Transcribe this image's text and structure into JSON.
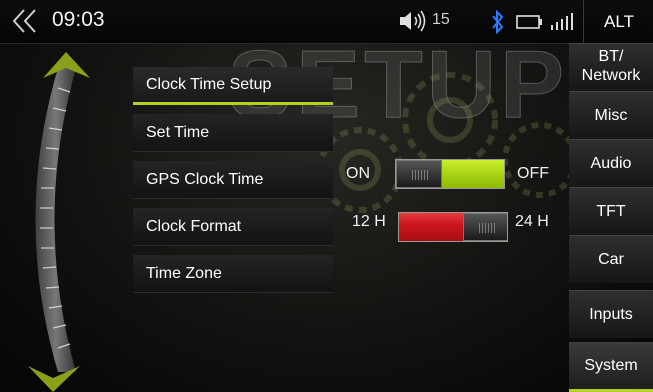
{
  "status": {
    "time": "09:03",
    "volume": "15",
    "alt_label": "ALT"
  },
  "background_title": "SETUP",
  "menu": [
    {
      "label": "Clock Time Setup",
      "active": true
    },
    {
      "label": "Set Time"
    },
    {
      "label": "GPS Clock Time"
    },
    {
      "label": "Clock Format"
    },
    {
      "label": "Time Zone"
    }
  ],
  "gps_toggle": {
    "left_label": "ON",
    "right_label": "OFF",
    "state": "ON",
    "on_color": "#a8d400"
  },
  "format_toggle": {
    "left_label": "12 H",
    "right_label": "24 H",
    "state": "12 H",
    "active_color": "#c8141b"
  },
  "side_tabs": [
    "BT/ Network",
    "Misc",
    "Audio",
    "TFT",
    "Car",
    "Inputs",
    "System"
  ],
  "active_tab": "System",
  "colors": {
    "accent": "#b6d01e",
    "bluetooth": "#2a7bff"
  }
}
